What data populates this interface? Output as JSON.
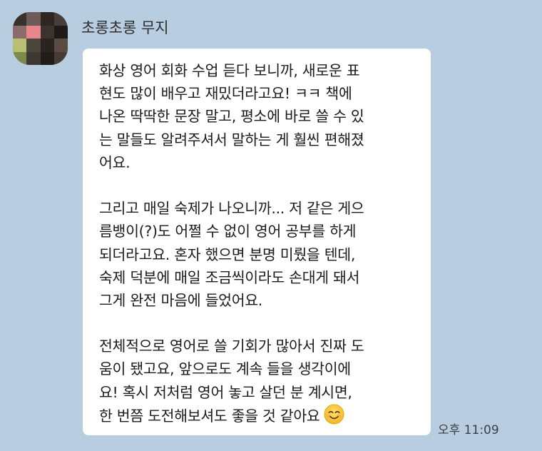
{
  "chat": {
    "sender_name": "초롱초롱 무지",
    "timestamp": "오후 11:09",
    "avatar": {
      "icon": "avatar-mosaic",
      "pixels": [
        "#3a302c",
        "#6e5a57",
        "#2d2622",
        "#4a3d37",
        "#8a6c6a",
        "#e8868c",
        "#3c332e",
        "#1f1a17",
        "#b9bf72",
        "#4b463c",
        "#2a2420",
        "#5a4c45",
        "#7c8a4c",
        "#3e3833",
        "#211c19",
        "#463b35"
      ]
    },
    "message": {
      "lines": [
        "화상 영어 회화 수업 듣다 보니까, 새로운 표",
        "현도 많이 배우고 재밌더라고요! ㅋㅋ 책에",
        "나온 딱딱한 문장 말고, 평소에 바로 쓸 수 있",
        "는 말들도 알려주셔서 말하는 게 훨씬 편해졌",
        "어요.",
        "",
        "그리고 매일 숙제가 나오니까... 저 같은 게으",
        "름뱅이(?)도 어쩔 수 없이 영어 공부를 하게",
        "되더라고요. 혼자 했으면 분명 미뤘을 텐데,",
        "숙제 덕분에 매일 조금씩이라도 손대게 돼서",
        "그게 완전 마음에 들었어요.",
        "",
        "전체적으로 영어로 쓸 기회가 많아서 진짜 도",
        "움이 됐고요, 앞으로도 계속 들을 생각이에",
        "요! 혹시 저처럼 영어 놓고 살던 분 계시면,",
        "한 번쯤 도전해보셔도 좋을 것 같아요"
      ],
      "emoji": "smiling-face-emoji"
    }
  }
}
